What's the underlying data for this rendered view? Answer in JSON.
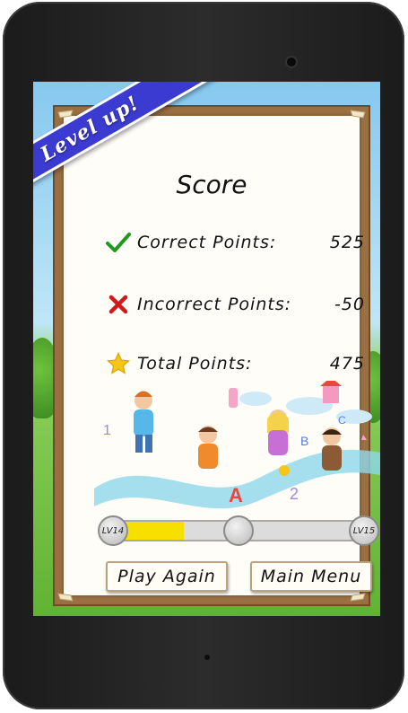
{
  "banner": {
    "text": "Level up!"
  },
  "score": {
    "title": "Score"
  },
  "rows": [
    {
      "icon": "check-icon",
      "label": "Correct Points:",
      "value": "525",
      "color": "#1e9a20"
    },
    {
      "icon": "cross-icon",
      "label": "Incorrect Points:",
      "value": "-50",
      "color": "#d11a1a"
    },
    {
      "icon": "star-icon",
      "label": "Total Points:",
      "value": "475",
      "color": "#f5c518"
    }
  ],
  "progress": {
    "from_level": "LV14",
    "to_level": "LV15",
    "fraction": 0.3,
    "fill_color": "#f7e000"
  },
  "buttons": {
    "play_again": "Play Again",
    "main_menu": "Main Menu"
  },
  "illustration": {
    "letters": [
      "1",
      "A",
      "B",
      "C",
      "2"
    ]
  }
}
